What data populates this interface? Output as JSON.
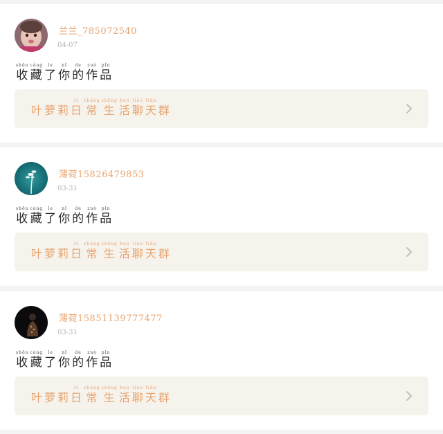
{
  "notifications": [
    {
      "username": "兰兰_785072540",
      "date": "04-07",
      "action": [
        {
          "py": "shōu",
          "zh": "收"
        },
        {
          "py": "cáng",
          "zh": "藏"
        },
        {
          "py": "le",
          "zh": "了"
        },
        {
          "py": "nǐ",
          "zh": "你"
        },
        {
          "py": "de",
          "zh": "的"
        },
        {
          "py": "zuò",
          "zh": "作"
        },
        {
          "py": "pǐn",
          "zh": "品"
        }
      ],
      "group": [
        {
          "py": "",
          "zh": "叶"
        },
        {
          "py": "",
          "zh": "萝"
        },
        {
          "py": "",
          "zh": "莉"
        },
        {
          "py": "rì",
          "zh": "日"
        },
        {
          "py": "cháng",
          "zh": "常"
        },
        {
          "py": "shēng",
          "zh": "生"
        },
        {
          "py": "huó",
          "zh": "活"
        },
        {
          "py": "liáo",
          "zh": "聊"
        },
        {
          "py": "tiān",
          "zh": "天"
        },
        {
          "py": "",
          "zh": "群"
        }
      ],
      "avatar": "baby-photo"
    },
    {
      "username": "薄荷15826479853",
      "date": "03-31",
      "action": [
        {
          "py": "shōu",
          "zh": "收"
        },
        {
          "py": "cáng",
          "zh": "藏"
        },
        {
          "py": "le",
          "zh": "了"
        },
        {
          "py": "nǐ",
          "zh": "你"
        },
        {
          "py": "de",
          "zh": "的"
        },
        {
          "py": "zuò",
          "zh": "作"
        },
        {
          "py": "pǐn",
          "zh": "品"
        }
      ],
      "group": [
        {
          "py": "",
          "zh": "叶"
        },
        {
          "py": "",
          "zh": "萝"
        },
        {
          "py": "",
          "zh": "莉"
        },
        {
          "py": "rì",
          "zh": "日"
        },
        {
          "py": "cháng",
          "zh": "常"
        },
        {
          "py": "shēng",
          "zh": "生"
        },
        {
          "py": "huó",
          "zh": "活"
        },
        {
          "py": "liáo",
          "zh": "聊"
        },
        {
          "py": "tiān",
          "zh": "天"
        },
        {
          "py": "",
          "zh": "群"
        }
      ],
      "avatar": "plant-photo"
    },
    {
      "username": "薄荷15851139777477",
      "date": "03-31",
      "action": [
        {
          "py": "shōu",
          "zh": "收"
        },
        {
          "py": "cáng",
          "zh": "藏"
        },
        {
          "py": "le",
          "zh": "了"
        },
        {
          "py": "nǐ",
          "zh": "你"
        },
        {
          "py": "de",
          "zh": "的"
        },
        {
          "py": "zuò",
          "zh": "作"
        },
        {
          "py": "pǐn",
          "zh": "品"
        }
      ],
      "group": [
        {
          "py": "",
          "zh": "叶"
        },
        {
          "py": "",
          "zh": "萝"
        },
        {
          "py": "",
          "zh": "莉"
        },
        {
          "py": "rì",
          "zh": "日"
        },
        {
          "py": "cháng",
          "zh": "常"
        },
        {
          "py": "shēng",
          "zh": "生"
        },
        {
          "py": "huó",
          "zh": "活"
        },
        {
          "py": "liáo",
          "zh": "聊"
        },
        {
          "py": "tiān",
          "zh": "天"
        },
        {
          "py": "",
          "zh": "群"
        }
      ],
      "avatar": "portrait-photo"
    }
  ],
  "colors": {
    "accent": "#e8a36f",
    "group_bg": "#f5f3ec",
    "page_bg": "#f4f3f3"
  },
  "icons": {
    "chevron": "chevron-right-icon"
  }
}
